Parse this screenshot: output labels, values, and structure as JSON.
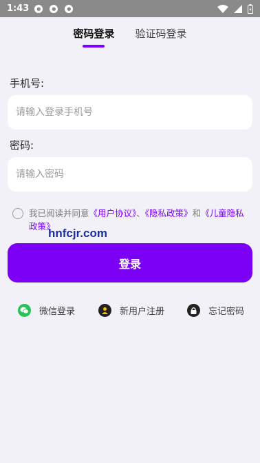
{
  "status_bar": {
    "time": "1:43",
    "notif_icons": [
      "notification-icon",
      "notification-icon",
      "notification-icon"
    ],
    "right_icons": [
      "wifi-icon",
      "signal-icon",
      "battery-icon"
    ]
  },
  "tabs": [
    {
      "label": "密码登录",
      "active": true
    },
    {
      "label": "验证码登录",
      "active": false
    }
  ],
  "phone": {
    "label": "手机号:",
    "placeholder": "请输入登录手机号"
  },
  "password": {
    "label": "密码:",
    "placeholder": "请输入密码"
  },
  "agreement": {
    "prefix": "我已阅读并同意",
    "user_agreement": "《用户协议》",
    "sep": "、",
    "privacy_policy": "《隐私政策》",
    "and": "和",
    "children_policy": "《儿童隐私政策》"
  },
  "watermark": "hnfcjr.com",
  "login_button": "登录",
  "bottom_links": {
    "wechat": "微信登录",
    "register": "新用户注册",
    "forgot": "忘记密码"
  },
  "colors": {
    "accent": "#7b00f5",
    "background": "#f2f1f7",
    "wechat": "#2bc25a"
  }
}
